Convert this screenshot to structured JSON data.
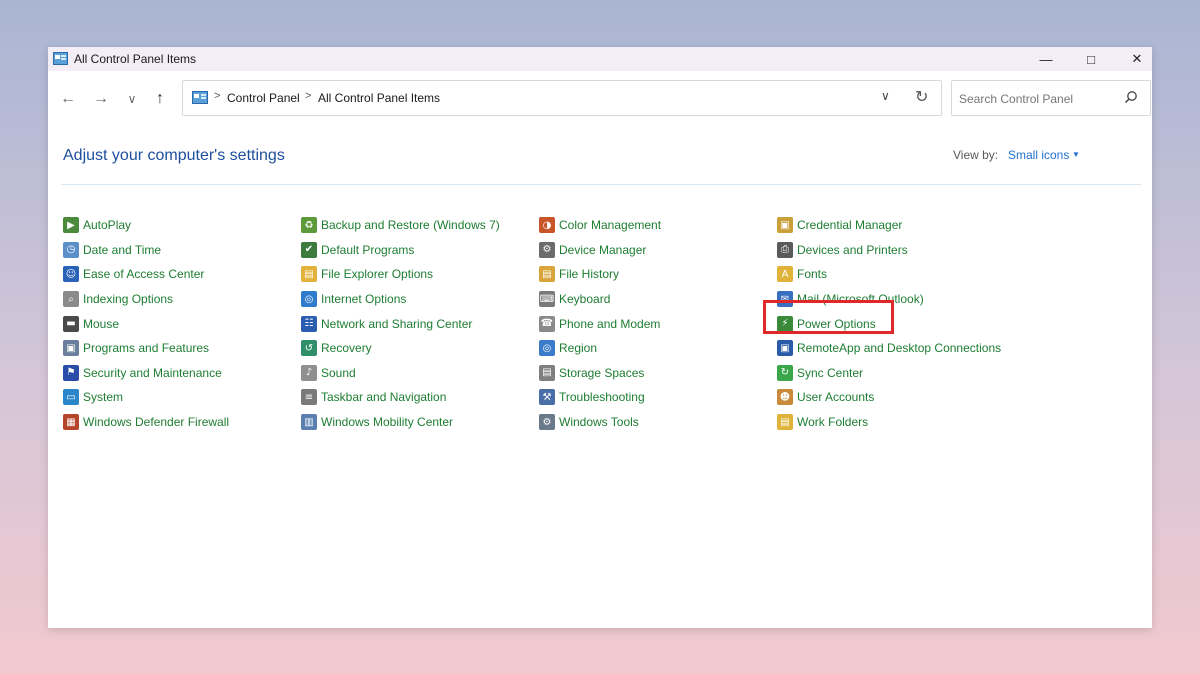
{
  "window": {
    "title": "All Control Panel Items",
    "minimize_label": "—",
    "maximize_label": "□",
    "close_label": "✕"
  },
  "nav": {
    "back_glyph": "←",
    "forward_glyph": "→",
    "recent_glyph": "∨",
    "up_glyph": "↑"
  },
  "address": {
    "sep": ">",
    "crumbs": [
      "Control Panel",
      "All Control Panel Items"
    ],
    "dropdown_glyph": "∨",
    "refresh_glyph": "↻"
  },
  "search": {
    "placeholder": "Search Control Panel"
  },
  "main": {
    "heading": "Adjust your computer's settings",
    "view_by_label": "View by:",
    "view_by_value": "Small icons",
    "view_by_caret": "▼"
  },
  "colors": {
    "item_link": "#1e7d32",
    "heading": "#1e4f9c",
    "accent": "#1f6fd0",
    "highlight": "#e02828"
  },
  "items": {
    "col1": [
      {
        "label": "AutoPlay",
        "icon": "autoplay-icon",
        "color": "#4a8a3a",
        "glyph": "▶"
      },
      {
        "label": "Date and Time",
        "icon": "date-time-icon",
        "color": "#5b8fc9",
        "glyph": "◷"
      },
      {
        "label": "Ease of Access Center",
        "icon": "ease-of-access-icon",
        "color": "#2a62b8",
        "glyph": "☺"
      },
      {
        "label": "Indexing Options",
        "icon": "indexing-icon",
        "color": "#8a8a8a",
        "glyph": "⌕"
      },
      {
        "label": "Mouse",
        "icon": "mouse-icon",
        "color": "#4a4a4a",
        "glyph": "▬"
      },
      {
        "label": "Programs and Features",
        "icon": "programs-icon",
        "color": "#6a7f9c",
        "glyph": "▣"
      },
      {
        "label": "Security and Maintenance",
        "icon": "flag-icon",
        "color": "#2a4ea8",
        "glyph": "⚑"
      },
      {
        "label": "System",
        "icon": "monitor-icon",
        "color": "#2b86c9",
        "glyph": "▭"
      },
      {
        "label": "Windows Defender Firewall",
        "icon": "firewall-icon",
        "color": "#b5452a",
        "glyph": "▦"
      }
    ],
    "col2": [
      {
        "label": "Backup and Restore (Windows 7)",
        "icon": "backup-icon",
        "color": "#5d9a3a",
        "glyph": "♻"
      },
      {
        "label": "Default Programs",
        "icon": "default-programs-icon",
        "color": "#3d7a3d",
        "glyph": "✔"
      },
      {
        "label": "File Explorer Options",
        "icon": "folder-icon",
        "color": "#e2b23a",
        "glyph": "▤"
      },
      {
        "label": "Internet Options",
        "icon": "globe-icon",
        "color": "#2f7ccc",
        "glyph": "◎"
      },
      {
        "label": "Network and Sharing Center",
        "icon": "network-icon",
        "color": "#2a5cb0",
        "glyph": "☷"
      },
      {
        "label": "Recovery",
        "icon": "recovery-icon",
        "color": "#2e8f6a",
        "glyph": "↺"
      },
      {
        "label": "Sound",
        "icon": "speaker-icon",
        "color": "#8f8f8f",
        "glyph": "♪"
      },
      {
        "label": "Taskbar and Navigation",
        "icon": "taskbar-icon",
        "color": "#7a7a7a",
        "glyph": "≡"
      },
      {
        "label": "Windows Mobility Center",
        "icon": "mobility-icon",
        "color": "#5a7fb0",
        "glyph": "▥"
      }
    ],
    "col3": [
      {
        "label": "Color Management",
        "icon": "color-management-icon",
        "color": "#c9552a",
        "glyph": "◑"
      },
      {
        "label": "Device Manager",
        "icon": "device-manager-icon",
        "color": "#6b6b6b",
        "glyph": "⚙"
      },
      {
        "label": "File History",
        "icon": "file-history-icon",
        "color": "#d9a43a",
        "glyph": "▤"
      },
      {
        "label": "Keyboard",
        "icon": "keyboard-icon",
        "color": "#7a7a7a",
        "glyph": "⌨"
      },
      {
        "label": "Phone and Modem",
        "icon": "phone-icon",
        "color": "#8a8a8a",
        "glyph": "☎"
      },
      {
        "label": "Region",
        "icon": "region-icon",
        "color": "#3a7cc9",
        "glyph": "◎"
      },
      {
        "label": "Storage Spaces",
        "icon": "storage-icon",
        "color": "#7f7f7f",
        "glyph": "▤"
      },
      {
        "label": "Troubleshooting",
        "icon": "troubleshoot-icon",
        "color": "#4a6fa8",
        "glyph": "⚒"
      },
      {
        "label": "Windows Tools",
        "icon": "tools-icon",
        "color": "#6a7a8a",
        "glyph": "⚙"
      }
    ],
    "col4": [
      {
        "label": "Credential Manager",
        "icon": "credential-icon",
        "color": "#c9a03a",
        "glyph": "▣"
      },
      {
        "label": "Devices and Printers",
        "icon": "printer-icon",
        "color": "#5a5a5a",
        "glyph": "⎙"
      },
      {
        "label": "Fonts",
        "icon": "fonts-icon",
        "color": "#e0b43a",
        "glyph": "A"
      },
      {
        "label": "Mail (Microsoft Outlook)",
        "icon": "mail-icon",
        "color": "#3a6fc0",
        "glyph": "✉"
      },
      {
        "label": "Power Options",
        "icon": "power-icon",
        "color": "#3a8a3a",
        "glyph": "⚡"
      },
      {
        "label": "RemoteApp and Desktop Connections",
        "icon": "remoteapp-icon",
        "color": "#2a5aa8",
        "glyph": "▣"
      },
      {
        "label": "Sync Center",
        "icon": "sync-icon",
        "color": "#3aa84a",
        "glyph": "↻"
      },
      {
        "label": "User Accounts",
        "icon": "user-accounts-icon",
        "color": "#c98a3a",
        "glyph": "☻"
      },
      {
        "label": "Work Folders",
        "icon": "work-folders-icon",
        "color": "#e0b43a",
        "glyph": "▤"
      }
    ]
  }
}
